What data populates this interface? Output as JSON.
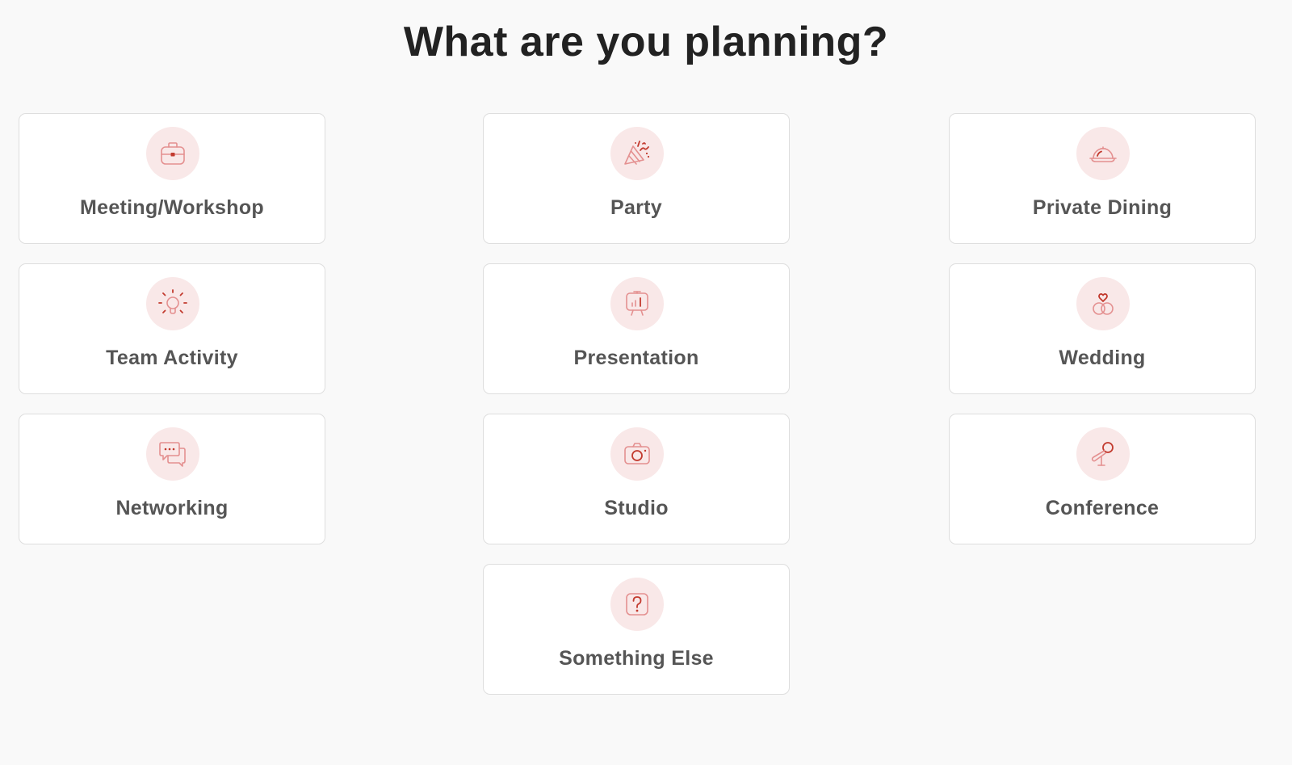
{
  "page": {
    "title": "What are you planning?"
  },
  "options": [
    {
      "label": "Meeting/Workshop",
      "icon": "briefcase-icon"
    },
    {
      "label": "Party",
      "icon": "party-popper-icon"
    },
    {
      "label": "Private Dining",
      "icon": "cloche-icon"
    },
    {
      "label": "Team Activity",
      "icon": "lightbulb-icon"
    },
    {
      "label": "Presentation",
      "icon": "presentation-board-icon"
    },
    {
      "label": "Wedding",
      "icon": "wedding-rings-icon"
    },
    {
      "label": "Networking",
      "icon": "chat-bubbles-icon"
    },
    {
      "label": "Studio",
      "icon": "camera-icon"
    },
    {
      "label": "Conference",
      "icon": "microphone-icon"
    },
    {
      "label": "Something Else",
      "icon": "question-mark-icon"
    }
  ],
  "colors": {
    "background": "#f9f9f9",
    "card_background": "#ffffff",
    "card_border": "#dedede",
    "icon_circle": "#f9e8e8",
    "icon_stroke_light": "#e49090",
    "icon_stroke_accent": "#c23a2e",
    "title_text": "#222222",
    "label_text": "#555555"
  }
}
